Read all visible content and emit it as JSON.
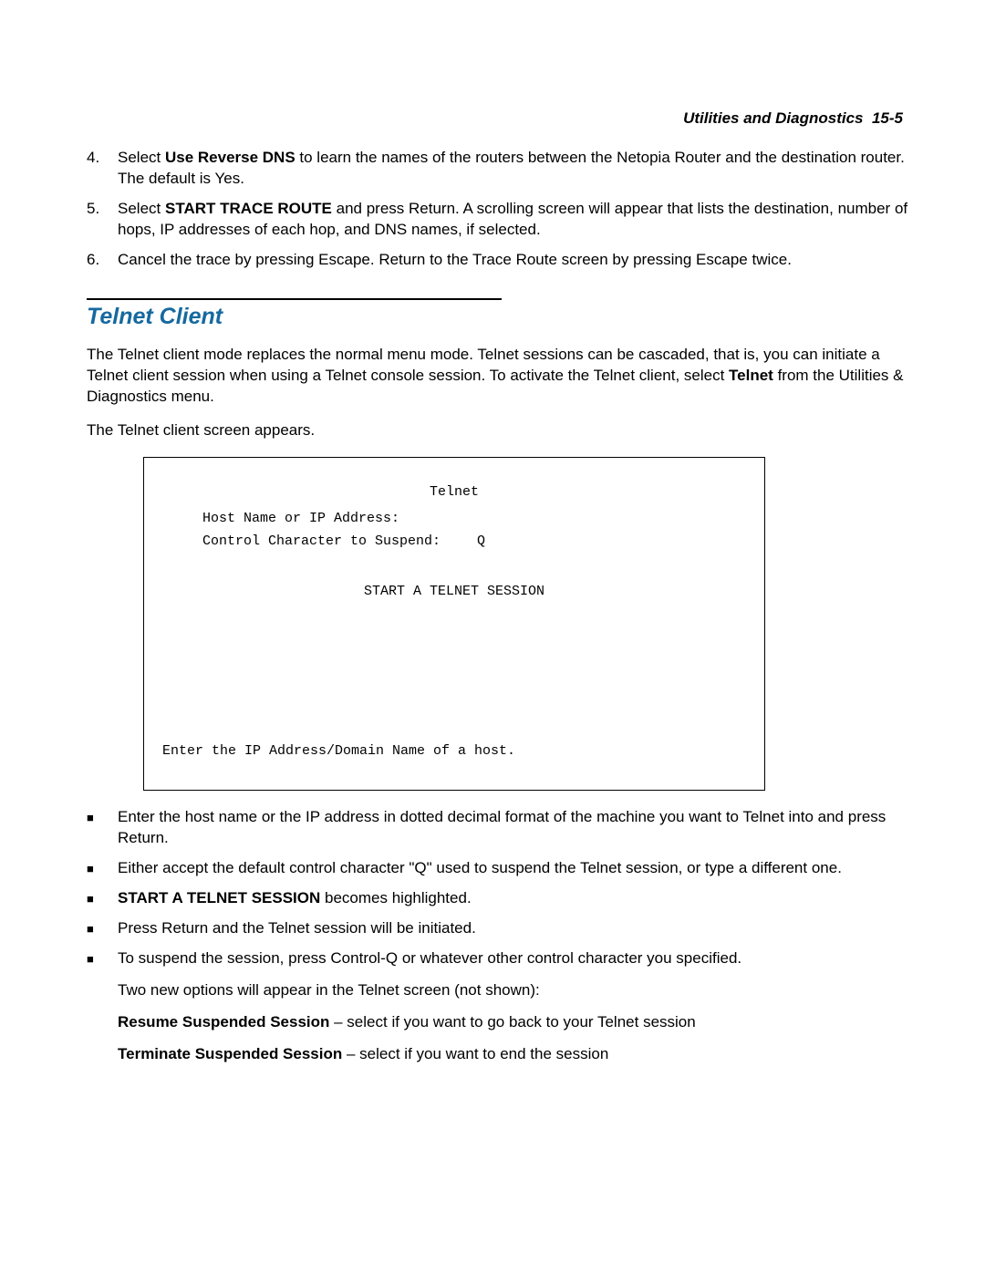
{
  "header": {
    "section_title": "Utilities and Diagnostics",
    "page_ref": "15-5"
  },
  "ordered_steps": {
    "start": 4,
    "items": [
      {
        "num": "4.",
        "lead_bold": "Use Reverse DNS",
        "before": "Select ",
        "after": " to learn the names of the routers between the Netopia Router and the destination router. The default is Yes."
      },
      {
        "num": "5.",
        "lead_bold": "START TRACE ROUTE",
        "before": "Select ",
        "after": " and press Return. A scrolling screen will appear that lists the destination, number of hops, IP addresses of each hop, and DNS names, if selected."
      },
      {
        "num": "6.",
        "plain": "Cancel the trace by pressing Escape. Return to the Trace Route screen by pressing Escape twice."
      }
    ]
  },
  "section": {
    "heading": "Telnet Client",
    "para1_before": "The Telnet client mode replaces the normal menu mode. Telnet sessions can be cascaded, that is, you can initiate a Telnet client session when using a Telnet console session. To activate the Telnet client, select ",
    "para1_bold": "Telnet",
    "para1_after": " from the Utilities & Diagnostics menu.",
    "para2": "The Telnet client screen appears."
  },
  "telnet_screen": {
    "title": "Telnet",
    "host_label": "Host Name or IP Address:",
    "ctrl_label": "Control Character to Suspend:",
    "ctrl_value": "Q",
    "start_label": "START A TELNET SESSION",
    "hint": "Enter the IP Address/Domain Name of a host."
  },
  "bullets": [
    {
      "plain": "Enter the host name or the IP address in dotted decimal format of the machine you want to Telnet into and press Return."
    },
    {
      "plain": "Either accept the default control character \"Q\" used to suspend the Telnet session, or type a different one."
    },
    {
      "bold_lead": "START A TELNET SESSION",
      "after": " becomes highlighted."
    },
    {
      "plain": "Press Return and the Telnet session will be initiated."
    },
    {
      "plain": "To suspend the session, press Control-Q or whatever other control character you specified."
    }
  ],
  "tail": {
    "intro": "Two new options will appear in the Telnet screen (not shown):",
    "resume_bold": "Resume Suspended Session",
    "resume_after": " – select if you want to go back to your Telnet session",
    "terminate_bold": "Terminate Suspended Session",
    "terminate_after": " – select if you want to end the session"
  }
}
